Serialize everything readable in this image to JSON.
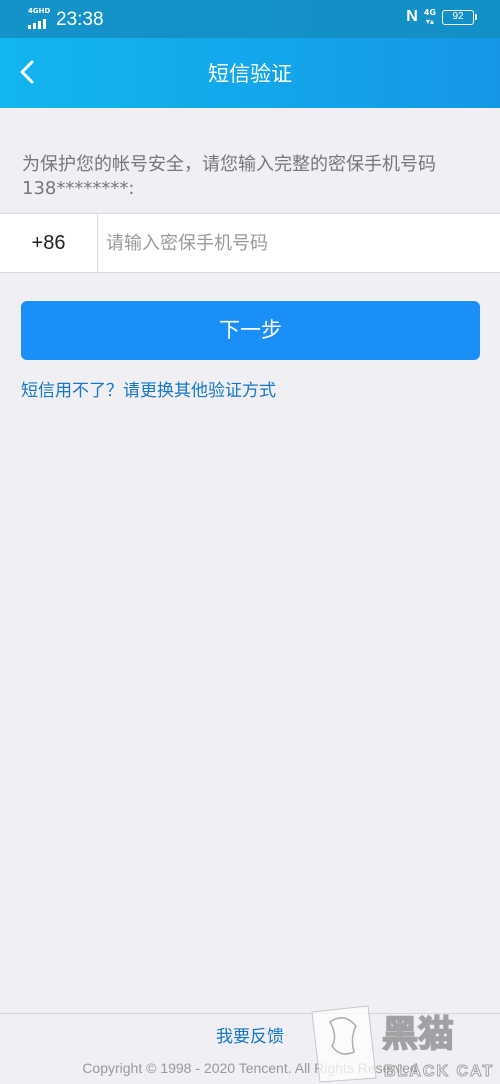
{
  "status_bar": {
    "network": "4GHD",
    "time": "23:38",
    "nfc_icon": "N",
    "data_network": "4G",
    "battery": "92"
  },
  "nav": {
    "title": "短信验证",
    "back_icon": "chevron-left-icon"
  },
  "form": {
    "hint": "为保护您的帐号安全，请您输入完整的密保手机号码138********:",
    "country_code": "+86",
    "phone_placeholder": "请输入密保手机号码",
    "phone_value": ""
  },
  "actions": {
    "next_label": "下一步",
    "alt_link": "短信用不了？请更换其他验证方式"
  },
  "footer": {
    "feedback": "我要反馈",
    "copyright": "Copyright © 1998 - 2020 Tencent. All Rights Reserved"
  },
  "watermark": {
    "text_cn": "黑猫",
    "text_en": "BLACK CAT"
  },
  "colors": {
    "nav_start": "#12b6f0",
    "nav_end": "#1597e6",
    "primary_button": "#1a8ff7",
    "link": "#1478c7",
    "background": "#efeff4"
  }
}
